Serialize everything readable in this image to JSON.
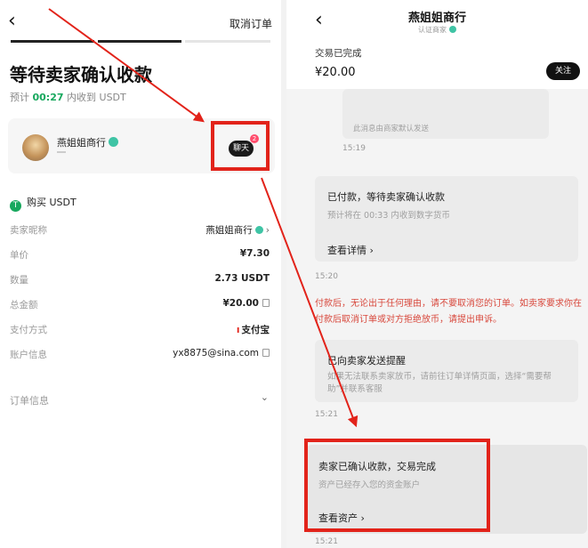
{
  "left": {
    "back_glyph": "‹",
    "cancel_order": "取消订单",
    "title": "等待卖家确认收款",
    "eta_prefix": "预计",
    "eta_time": "00:27",
    "eta_suffix": "内收到 USDT",
    "seller": {
      "name": "燕姐姐商行",
      "chat_label": "聊天",
      "unread": "2"
    },
    "buy_heading": "购买 USDT",
    "details": [
      {
        "label": "卖家昵称",
        "value": "燕姐姐商行"
      },
      {
        "label": "单价",
        "value": "¥7.30"
      },
      {
        "label": "数量",
        "value": "2.73 USDT"
      },
      {
        "label": "总金额",
        "value": "¥20.00"
      },
      {
        "label": "支付方式",
        "value": "支付宝"
      },
      {
        "label": "账户信息",
        "value": "yx8875@sina.com"
      }
    ],
    "order_info": "订单信息"
  },
  "right": {
    "title": "燕姐姐商行",
    "verified_label": "认证商家",
    "trade_status": "交易已完成",
    "amount": "¥20.00",
    "follow": "关注",
    "msg_default": "此消息由商家默认发送",
    "ts1": "15:19",
    "card1": {
      "title": "已付款，等待卖家确认收款",
      "sub": "预计将在 00:33 内收到数字货币",
      "link": "查看详情 ›"
    },
    "ts2": "15:20",
    "warning": "付款后，无论出于任何理由，请不要取消您的订单。如卖家要求你在付款后取消订单或对方拒绝放币，请提出申诉。",
    "card2": {
      "title": "已向卖家发送提醒",
      "sub": "如果无法联系卖家放币，请前往订单详情页面，选择“需要帮助”并联系客服"
    },
    "ts3": "15:21",
    "card3": {
      "title": "卖家已确认收款，交易完成",
      "sub": "资产已经存入您的资金账户",
      "link": "查看资产 ›"
    },
    "ts4": "15:21"
  },
  "colors": {
    "accent_red": "#e2231a",
    "green": "#18a85e"
  }
}
